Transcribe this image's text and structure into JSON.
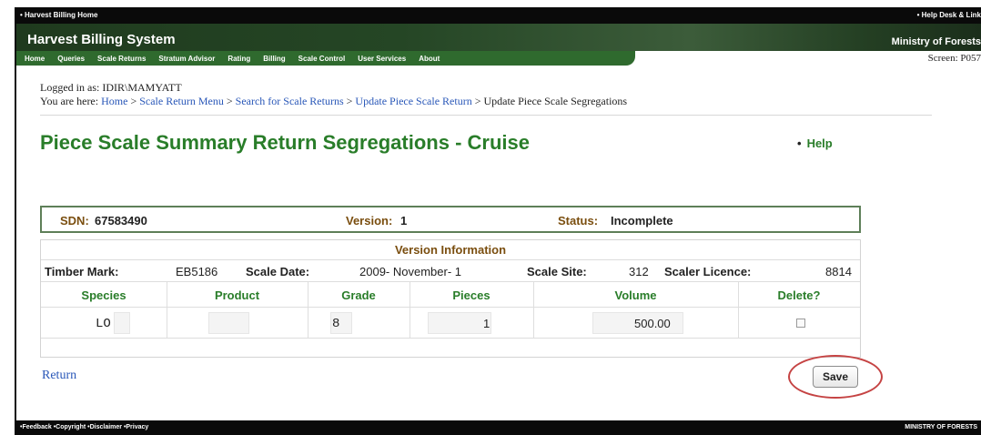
{
  "topbar": {
    "left": "• Harvest Billing Home",
    "right": "• Help Desk & Link"
  },
  "banner": {
    "title": "Harvest Billing System",
    "ministry": "Ministry of Forests"
  },
  "nav": {
    "items": [
      "Home",
      "Queries",
      "Scale Returns",
      "Stratum Advisor",
      "Rating",
      "Billing",
      "Scale Control",
      "User Services",
      "About"
    ]
  },
  "screen_id": "Screen: P057",
  "user": {
    "logged_in": "Logged in as: IDIR\\MAMYATT"
  },
  "breadcrumb": {
    "prefix": "You are here:",
    "links": [
      "Home",
      "Scale Return Menu",
      "Search for Scale Returns",
      "Update Piece Scale Return"
    ],
    "separator": ">",
    "current": "Update Piece Scale Segregations"
  },
  "page": {
    "title": "Piece Scale Summary Return Segregations - Cruise",
    "help": "Help"
  },
  "summary": {
    "sdn_label": "SDN:",
    "sdn_value": "67583490",
    "version_label": "Version:",
    "version_value": "1",
    "status_label": "Status:",
    "status_value": "Incomplete"
  },
  "version_info": {
    "header": "Version Information",
    "timber_mark_label": "Timber Mark:",
    "timber_mark_value": "EB5186",
    "scale_date_label": "Scale Date:",
    "scale_date_value": "2009- November- 1",
    "scale_site_label": "Scale Site:",
    "scale_site_value": "312",
    "scaler_licence_label": "Scaler Licence:",
    "scaler_licence_value": "8814"
  },
  "table": {
    "columns": [
      "Species",
      "Product",
      "Grade",
      "Pieces",
      "Volume",
      "Delete?"
    ],
    "rows": [
      {
        "species": "LO",
        "product": "",
        "grade": "8",
        "pieces": "1",
        "volume": "500.00",
        "delete": false
      }
    ]
  },
  "actions": {
    "return_label": "Return",
    "save_label": "Save"
  },
  "footer": {
    "left": "•Feedback •Copyright •Disclaimer •Privacy",
    "right": "MINISTRY OF FORESTS"
  },
  "colors": {
    "banner": "#254625",
    "nav": "#2f6a2e",
    "title_green": "#297d29",
    "label_brown": "#7a4e0f",
    "link_blue": "#2957b8",
    "highlight_ring": "#c54343"
  }
}
